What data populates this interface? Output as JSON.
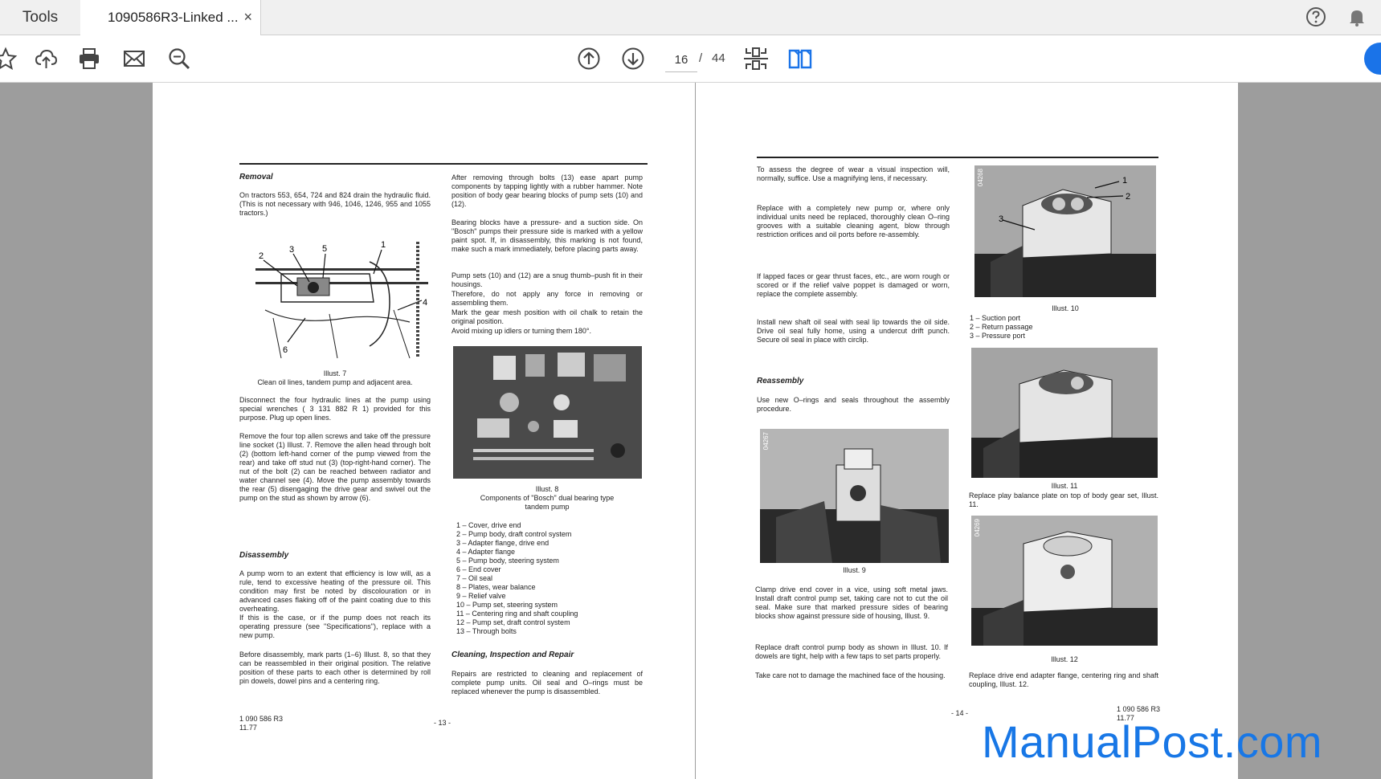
{
  "tabs": {
    "tools_label": "Tools",
    "doc_tab_label": "1090586R3-Linked ...",
    "close_glyph": "×"
  },
  "toolbar": {
    "current_page": "16",
    "separator": "/",
    "total_pages": "44",
    "icons": [
      "star-icon",
      "cloud-upload-icon",
      "print-icon",
      "mail-icon",
      "zoom-search-icon",
      "page-up-icon",
      "page-down-icon",
      "fit-page-icon",
      "two-page-view-icon"
    ]
  },
  "left_page": {
    "removal_heading": "Removal",
    "removal_text": "On tractors 553, 654, 724 and 824 drain the hydraulic fluid. (This is not necessary with 946, 1046, 1246, 955 and 1055 tractors.)",
    "illust7_title": "Illust. 7",
    "illust7_caption": "Clean oil lines, tandem pump and adjacent area.",
    "para_disconnect": "Disconnect the four hydraulic lines at the pump using special wrenches ( 3 131 882 R 1) provided for this purpose. Plug up open lines.",
    "para_remove": "Remove the four top allen screws and take off the pressure line socket (1) Illust. 7. Remove the allen head through bolt (2) (bottom left-hand corner of the pump viewed from the rear) and take off stud nut (3) (top-right-hand corner). The nut of the bolt (2) can be reached between radiator and water channel see (4). Move the pump assembly towards the rear (5) disengaging the drive gear and swivel out the pump on the stud as shown by arrow (6).",
    "disassembly_heading": "Disassembly",
    "para_worn": "A pump worn to an extent that efficiency is low will, as a rule, tend to excessive heating of the pressure oil. This condition may first be noted by discolouration or in advanced cases flaking off of the paint coating due to this overheating.",
    "para_if": "If this is the case, or if the pump does not reach its operating pressure (see \"Specifications\"), replace with a new pump.",
    "para_before": "Before disassembly, mark parts (1–6) Illust. 8, so that they can be reassembled in their original position. The relative position of these parts to each other is determined by roll pin dowels, dowel pins and a centering ring.",
    "para_after": "After removing through bolts (13) ease apart pump components by tapping lightly with a rubber hammer. Note position of body gear bearing blocks of pump sets (10) and (12).",
    "para_bearing": "Bearing blocks have a pressure- and a suction side. On \"Bosch\" pumps their pressure side is marked with a yellow paint spot. If, in disassembly, this marking is not found, make such a mark immediately, before placing parts away.",
    "para_pumpsets": "Pump sets (10) and (12) are a snug thumb–push fit in their housings.",
    "para_therefore": "Therefore, do not apply any force in removing or assembling them.",
    "para_mark": "Mark the gear mesh position with oil chalk to retain the original position.",
    "para_avoid": "Avoid mixing up idlers or turning them 180°.",
    "illust8_title": "Illust. 8",
    "illust8_caption": "Components of \"Bosch\" dual bearing type tandem pump",
    "parts": [
      "1 – Cover, drive end",
      "2 – Pump body, draft control system",
      "3 – Adapter flange, drive end",
      "4 – Adapter flange",
      "5 – Pump body, steering system",
      "6 – End cover",
      "7 – Oil seal",
      "8 – Plates, wear balance",
      "9 – Relief valve",
      "10 – Pump set, steering system",
      "11 – Centering ring and shaft coupling",
      "12 – Pump set, draft control system",
      "13 – Through bolts"
    ],
    "cleaning_heading": "Cleaning, Inspection and Repair",
    "para_repairs": "Repairs are restricted to cleaning and replacement of complete pump units. Oil seal and O–rings must be replaced whenever the pump is disassembled.",
    "footer_code": "1 090 586 R3",
    "footer_date": "11.77",
    "page_number": "- 13 -"
  },
  "right_page": {
    "para_assess": "To assess the degree of wear a visual inspection will, normally, suffice. Use a magnifying lens, if necessary.",
    "para_replace": "Replace with a completely new pump or, where only individual units need be replaced, thoroughly clean O–ring grooves with a suitable cleaning agent, blow through restriction orifices and oil ports before re-assembly.",
    "para_lapped": "If lapped faces or gear thrust faces, etc., are worn rough or scored or if the relief valve poppet is damaged or worn, replace the complete assembly.",
    "para_install": "Install new shaft oil seal with seal lip towards the oil side. Drive oil seal fully home, using a undercut drift punch. Secure oil seal in place with circlip.",
    "reassembly_heading": "Reassembly",
    "para_use": "Use new O–rings and seals throughout the assembly procedure.",
    "illust9_title": "Illust. 9",
    "para_clamp": "Clamp drive end cover in a vice, using soft metal jaws. Install draft control pump set, taking care not to cut the oil seal. Make sure that marked pressure sides of bearing blocks show against pressure side of housing, Illust. 9.",
    "para_replace_draft": "Replace draft control pump body as shown in Illust. 10. If dowels are tight, help with a few taps to set parts properly.",
    "para_take": "Take care not to damage the machined face of the housing.",
    "illust10_title": "Illust. 10",
    "ports": [
      "1 – Suction port",
      "2 – Return passage",
      "3 – Pressure port"
    ],
    "illust11_title": "Illust. 11",
    "para_play": "Replace play balance plate on top of body gear set, Illust. 11.",
    "illust12_title": "Illust. 12",
    "para_drive": "Replace drive end adapter flange, centering ring and shaft coupling, Illust. 12.",
    "footer_code": "1 090 586 R3",
    "footer_date": "11.77",
    "page_number": "- 14 -",
    "photo_codes": [
      "04268",
      "04267",
      "04269"
    ]
  },
  "watermark": "ManualPost.com",
  "colors": {
    "accent": "#1a73e8",
    "watermark": "#1877e6",
    "viewer_bg": "#9d9d9d"
  }
}
